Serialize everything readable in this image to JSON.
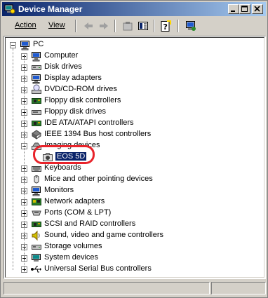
{
  "window": {
    "title": "Device Manager"
  },
  "titlebar_buttons": {
    "minimize": "minimize-icon",
    "maximize": "maximize-icon",
    "close": "close-icon"
  },
  "menu": {
    "action": "Action",
    "view": "View"
  },
  "toolbar": [
    "back-arrow-icon",
    "forward-arrow-icon",
    "properties-icon",
    "view-icon",
    "help-icon",
    "scan-hardware-icon"
  ],
  "tree": {
    "root": "PC",
    "items": [
      {
        "label": "Computer",
        "icon": "computer-icon"
      },
      {
        "label": "Disk drives",
        "icon": "disk-drive-icon"
      },
      {
        "label": "Display adapters",
        "icon": "display-adapter-icon"
      },
      {
        "label": "DVD/CD-ROM drives",
        "icon": "cdrom-icon"
      },
      {
        "label": "Floppy disk controllers",
        "icon": "floppy-controller-icon"
      },
      {
        "label": "Floppy disk drives",
        "icon": "floppy-drive-icon"
      },
      {
        "label": "IDE ATA/ATAPI controllers",
        "icon": "ide-controller-icon"
      },
      {
        "label": "IEEE 1394 Bus host controllers",
        "icon": "firewire-icon"
      },
      {
        "label": "Imaging devices",
        "icon": "imaging-icon",
        "expanded": true
      },
      {
        "label": "EOS 5D",
        "icon": "camera-icon",
        "child": true,
        "selected": true
      },
      {
        "label": "Keyboards",
        "icon": "keyboard-icon"
      },
      {
        "label": "Mice and other pointing devices",
        "icon": "mouse-icon"
      },
      {
        "label": "Monitors",
        "icon": "monitor-icon"
      },
      {
        "label": "Network adapters",
        "icon": "network-adapter-icon"
      },
      {
        "label": "Ports (COM & LPT)",
        "icon": "port-icon"
      },
      {
        "label": "SCSI and RAID controllers",
        "icon": "scsi-icon"
      },
      {
        "label": "Sound, video and game controllers",
        "icon": "sound-icon"
      },
      {
        "label": "Storage volumes",
        "icon": "storage-volume-icon"
      },
      {
        "label": "System devices",
        "icon": "system-device-icon"
      },
      {
        "label": "Universal Serial Bus controllers",
        "icon": "usb-icon"
      }
    ]
  },
  "colors": {
    "selection": "#0a246a",
    "highlight_ring": "#e8232a",
    "titlebar_start": "#0a246a",
    "titlebar_end": "#a6caf0"
  }
}
